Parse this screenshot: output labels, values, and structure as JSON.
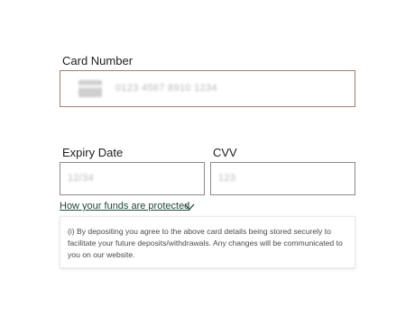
{
  "card_number": {
    "label": "Card Number",
    "placeholder": "0123 4567 8910 1234",
    "icon": "credit-card-icon"
  },
  "expiry_date": {
    "label": "Expiry Date",
    "placeholder": "12/34"
  },
  "cvv": {
    "label": "CVV",
    "placeholder": "123"
  },
  "funds_link": {
    "text": "How your funds are protected",
    "icon": "chevron-down-icon",
    "color": "#1f4a3a"
  },
  "info": {
    "text": "(i) By depositing you agree to the above card details being stored securely to facilitate your future deposits/withdrawals. Any changes will be communicated to you on our website."
  },
  "colors": {
    "card_field_border": "#a27f6e",
    "field_border": "#8a8a8a"
  }
}
